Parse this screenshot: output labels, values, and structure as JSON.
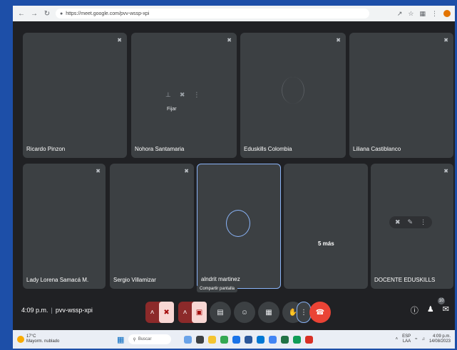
{
  "browser": {
    "url": "https://meet.google.com/pvv-wssp-xpi",
    "back_icon": "arrow-left",
    "forward_icon": "arrow-right",
    "reload_icon": "reload"
  },
  "participants": [
    {
      "name": "Ricardo Pinzon"
    },
    {
      "name": "Nohora Santamaria"
    },
    {
      "name": "Eduskills Colombia"
    },
    {
      "name": "Liliana Castiblanco"
    },
    {
      "name": "Lady Lorena Samacá M."
    },
    {
      "name": "Sergio Villamizar"
    },
    {
      "name": "alndrit martinez"
    },
    {
      "name": ""
    },
    {
      "name": "DOCENTE EDUSKILLS"
    }
  ],
  "tile_overlay": {
    "fix_label": "Fijar"
  },
  "more_tile": {
    "label": "5 más"
  },
  "bottom_bar": {
    "time": "4:09 p.m.",
    "separator": "|",
    "meeting_code": "pvv-wssp-xpi",
    "tooltip": "Compartir pantalla",
    "badge_count": "10"
  },
  "taskbar": {
    "weather_temp": "17°C",
    "weather_desc": "Mayorm. nublado",
    "search_placeholder": "Buscar",
    "lang_top": "ESP",
    "lang_bottom": "LAA",
    "clock_time": "4:09 p.m.",
    "clock_date": "14/08/2023"
  },
  "colors": {
    "background": "#202124",
    "tile": "#3c4043",
    "accent": "#8ab4f8",
    "end_call": "#ea4335"
  }
}
